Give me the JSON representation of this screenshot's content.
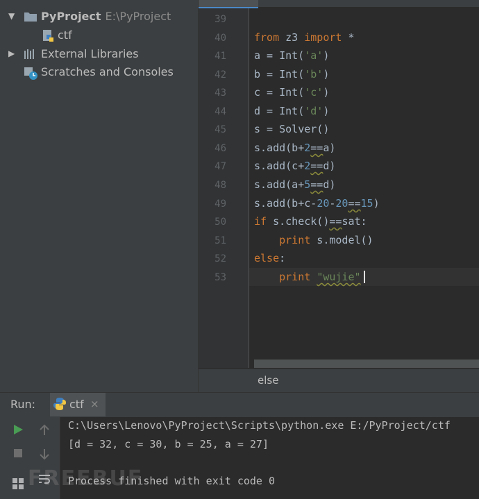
{
  "project_tree": {
    "root_name": "PyProject",
    "root_path": "E:\\PyProject",
    "child_file": "ctf",
    "external_libraries": "External Libraries",
    "scratches": "Scratches and Consoles"
  },
  "editor": {
    "lines": [
      {
        "n": "39",
        "code": ""
      },
      {
        "n": "40",
        "code": "from z3 import *"
      },
      {
        "n": "41",
        "code": "a = Int('a')"
      },
      {
        "n": "42",
        "code": "b = Int('b')"
      },
      {
        "n": "43",
        "code": "c = Int('c')"
      },
      {
        "n": "44",
        "code": "d = Int('d')"
      },
      {
        "n": "45",
        "code": "s = Solver()"
      },
      {
        "n": "46",
        "code": "s.add(b+2==a)"
      },
      {
        "n": "47",
        "code": "s.add(c+2==d)"
      },
      {
        "n": "48",
        "code": "s.add(a+5==d)"
      },
      {
        "n": "49",
        "code": "s.add(b+c-20-20==15)"
      },
      {
        "n": "50",
        "code": "if s.check()==sat:"
      },
      {
        "n": "51",
        "code": "    print s.model()"
      },
      {
        "n": "52",
        "code": "else:"
      },
      {
        "n": "53",
        "code": "    print \"wujie\""
      }
    ],
    "breadcrumb": "else"
  },
  "run": {
    "label": "Run:",
    "tab_name": "ctf",
    "close_glyph": "×",
    "output": [
      "C:\\Users\\Lenovo\\PyProject\\Scripts\\python.exe E:/PyProject/ctf",
      "[d = 32, c = 30, b = 25, a = 27]",
      "",
      "Process finished with exit code 0"
    ]
  },
  "watermark": "FREEBUF",
  "colors": {
    "keyword": "#cc7832",
    "number": "#6897bb",
    "string": "#6a8759",
    "run_green": "#499c54",
    "folder_icon": "#8f9eac"
  }
}
